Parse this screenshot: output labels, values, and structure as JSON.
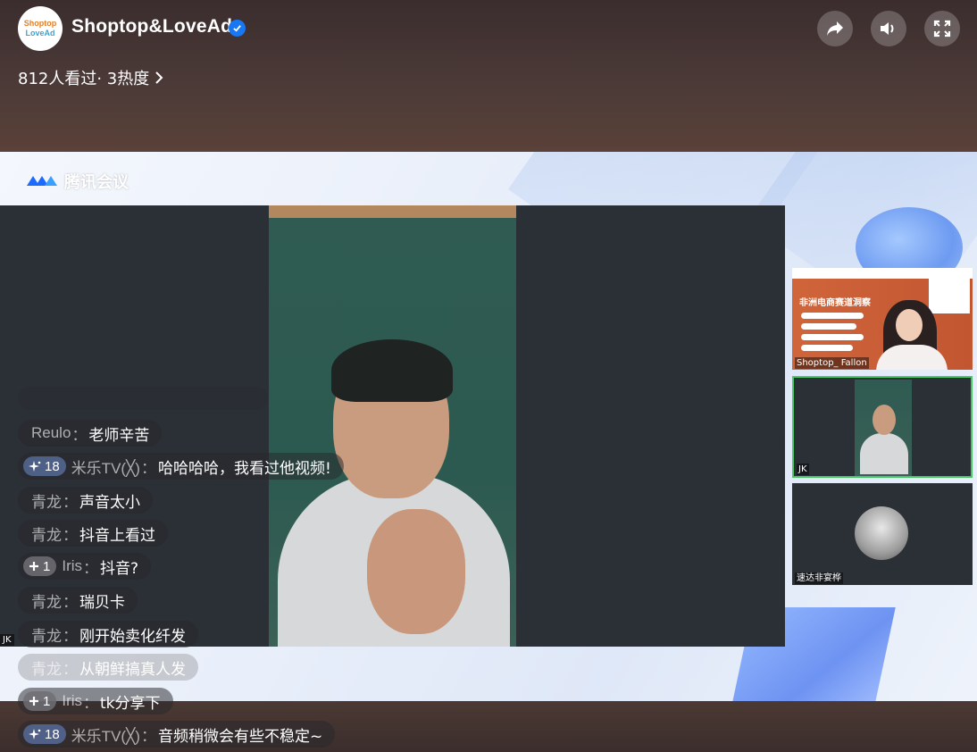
{
  "header": {
    "channel_name": "Shoptop&LoveAd",
    "avatar_line1": "Shoptop",
    "avatar_line2": "LoveAd",
    "view_stats": "812人看过· 3热度",
    "verified": true,
    "buttons": [
      "share-icon",
      "volume-icon",
      "fullscreen-icon"
    ]
  },
  "meeting": {
    "app_name": "腾讯会议",
    "main_label": "JK",
    "participants": [
      {
        "name": "Shoptop_ Fallon",
        "slide_title": "非洲电商赛道洞察"
      },
      {
        "name": "JK",
        "active": true
      },
      {
        "name": "速达非宴桦"
      }
    ]
  },
  "chat": [
    {
      "user": "Reulo",
      "text": "老师辛苦"
    },
    {
      "badge": "18",
      "badge_icon": "sparkle-icon",
      "user": "米乐TV(╳)",
      "text": "哈哈哈哈，我看过他视频!"
    },
    {
      "user": "青龙",
      "text": "声音太小"
    },
    {
      "user": "青龙",
      "text": "抖音上看过"
    },
    {
      "badge": "1",
      "badge_icon": "plus-icon",
      "user": "Iris",
      "text": "抖音?"
    },
    {
      "user": "青龙",
      "text": "瑞贝卡"
    },
    {
      "user": "青龙",
      "text": "刚开始卖化纤发"
    },
    {
      "user": "青龙",
      "text": "从朝鲜搞真人发"
    },
    {
      "badge": "1",
      "badge_icon": "plus-icon",
      "user": "Iris",
      "text": "tk分享下"
    },
    {
      "badge": "18",
      "badge_icon": "sparkle-icon",
      "user": "米乐TV(╳)",
      "text": "音频稍微会有些不稳定~"
    }
  ],
  "colors": {
    "verified": "#1877f2",
    "active_border": "#46c866",
    "badge_level": "#566a96"
  }
}
